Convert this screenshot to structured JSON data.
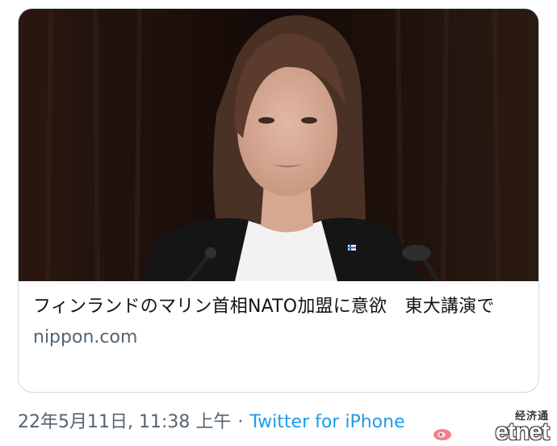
{
  "card": {
    "headline": "フィンランドのマリン首相NATO加盟に意欲　東大講演で",
    "domain": "nippon.com",
    "image": "photo-of-speaker-at-podium"
  },
  "meta": {
    "timestamp": "22年5月11日, 11:38 上午",
    "separator": "·",
    "source": "Twitter for iPhone"
  },
  "watermark": {
    "cn": "经济通",
    "logo": "etnet",
    "weibo": "weibo-icon"
  },
  "colors": {
    "text": "#0f1419",
    "secondary": "#536471",
    "link": "#1d9bf0",
    "border": "#cfd9de"
  }
}
